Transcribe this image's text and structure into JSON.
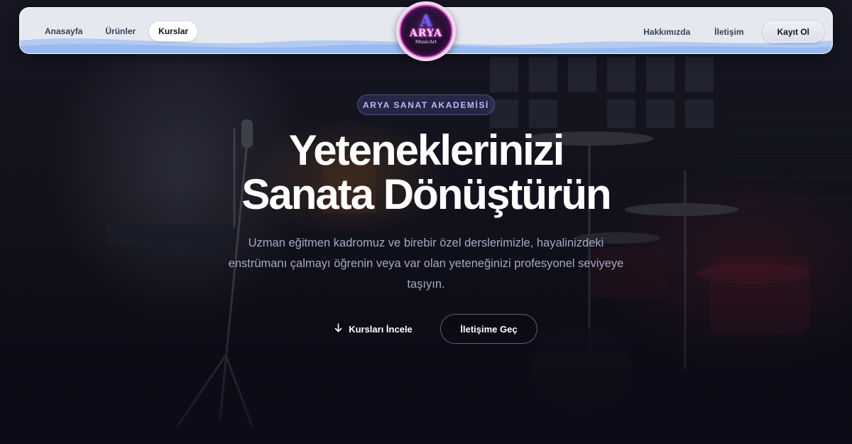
{
  "nav": {
    "left": [
      {
        "label": "Anasayfa",
        "active": false
      },
      {
        "label": "Ürünler",
        "active": false
      },
      {
        "label": "Kurslar",
        "active": true
      }
    ],
    "right": [
      {
        "label": "Hakkımızda"
      },
      {
        "label": "İletişim"
      }
    ],
    "register_label": "Kayıt Ol"
  },
  "logo": {
    "mark": "A",
    "name": "ARYA",
    "sub": "MusicArt"
  },
  "hero": {
    "badge": "ARYA SANAT AKADEMİSİ",
    "title_line1": "Yeteneklerinizi",
    "title_line2": "Sanata Dönüştürün",
    "subtitle": "Uzman eğitmen kadromuz ve birebir özel derslerimizle, hayalinizdeki enstrümanı çalmayı öğrenin veya var olan yeteneğinizi profesyonel seviyeye taşıyın.",
    "primary_button": "Kursları İncele",
    "secondary_button": "İletişime Geç"
  },
  "icons": {
    "primary_button_icon": "arrow-down-icon"
  },
  "colors": {
    "background": "#0d0e1a",
    "badge_text": "#b7bcf5",
    "subtitle_text": "#a6a9c0",
    "logo_ring": "#c235a8"
  }
}
